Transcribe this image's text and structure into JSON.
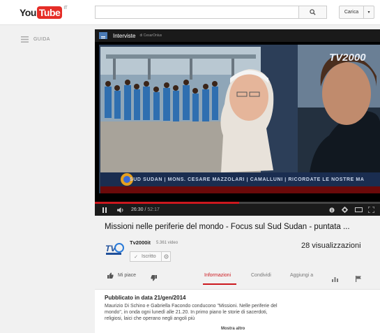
{
  "header": {
    "logo_you": "You",
    "logo_tube": "Tube",
    "logo_region": "IT",
    "search_placeholder": "",
    "upload_label": "Carica"
  },
  "guide": {
    "label": "GUIDA"
  },
  "player": {
    "playlist_title": "Interviste",
    "channel_credit": "di CesarOnlus",
    "ticker_text": "SUD SUDAN | MONS. CESARE MAZZOLARI | CAMALLUNI | RICORDATE LE NOSTRE MA",
    "broadcaster_logo": "TV2000",
    "current_time": "26:30",
    "duration": "52:17",
    "progress_fraction": 0.507
  },
  "video": {
    "title": "Missioni nelle periferie del mondo - Focus sul Sud Sudan - puntata ...",
    "channel_name": "Tv2000it",
    "video_count": "5.361 video",
    "subscribe_label": "Iscritto",
    "views": "28 visualizzazioni"
  },
  "actions": {
    "like_label": "Mi piace",
    "tab_info": "Informazioni",
    "tab_share": "Condividi",
    "tab_add": "Aggiungi a"
  },
  "description": {
    "published": "Pubblicato in data 21/gen/2014",
    "text": "Maurizio Di Schino e Gabriella Facondo conducono \"Missioni. Nelle periferie del mondo\", in onda ogni lunedì alle 21.20. In primo piano le storie di sacerdoti, religiosi, laici che operano negli angoli più",
    "show_more": "Mostra altro"
  },
  "colors": {
    "accent": "#cc181e",
    "youtube_red": "#e52d27"
  }
}
